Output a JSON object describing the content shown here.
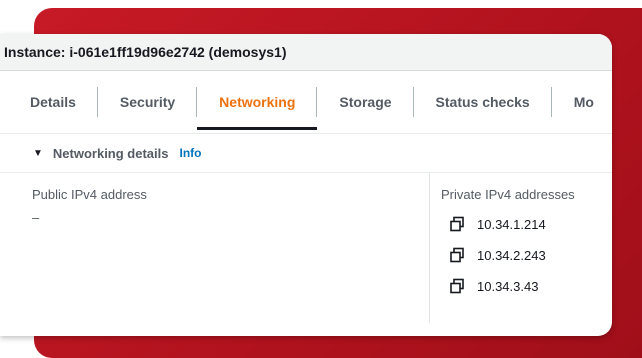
{
  "window": {
    "title": "Instance: i-061e1ff19d96e2742 (demosys1)"
  },
  "tabs": [
    {
      "label": "Details",
      "active": false
    },
    {
      "label": "Security",
      "active": false
    },
    {
      "label": "Networking",
      "active": true
    },
    {
      "label": "Storage",
      "active": false
    },
    {
      "label": "Status checks",
      "active": false
    },
    {
      "label": "Mo",
      "active": false
    }
  ],
  "section": {
    "title": "Networking details",
    "info_link": "Info"
  },
  "fields": {
    "public_ipv4": {
      "label": "Public IPv4 address",
      "value": "–"
    },
    "private_ipv4": {
      "label": "Private IPv4 addresses",
      "values": [
        "10.34.1.214",
        "10.34.2.243",
        "10.34.3.43"
      ]
    }
  },
  "colors": {
    "background_accent": "#c71a26",
    "active_tab": "#ec7211",
    "info_link": "#0073bb"
  },
  "icons": {
    "caret": "caret-down-icon",
    "copy": "copy-icon"
  }
}
